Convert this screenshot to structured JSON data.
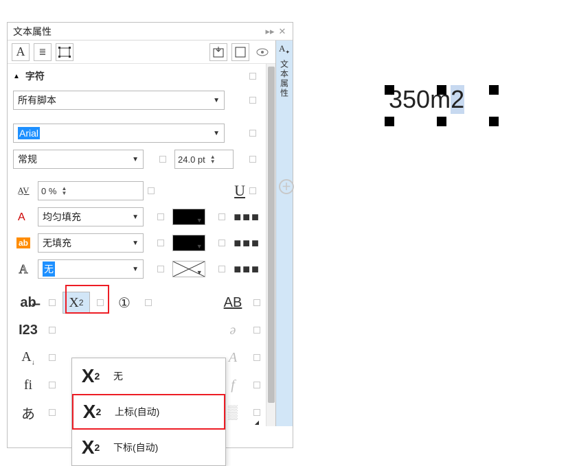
{
  "panel": {
    "title": "文本属性",
    "side_tab_label": "文本属性"
  },
  "section": {
    "title": "字符"
  },
  "fields": {
    "script": {
      "value": "所有脚本"
    },
    "font_family": {
      "value": "Arial"
    },
    "font_style": {
      "value": "常规"
    },
    "font_size": {
      "value": "24.0 pt"
    },
    "kerning": {
      "value": "0 %"
    },
    "fill_type": {
      "value": "均匀填充"
    },
    "bg_fill_type": {
      "value": "无填充"
    },
    "outline": {
      "value": "无"
    },
    "underline_label": "U"
  },
  "popup": {
    "items": [
      {
        "label": "无",
        "mode": "sup"
      },
      {
        "label": "上标(自动)",
        "mode": "sup"
      },
      {
        "label": "下标(自动)",
        "mode": "sub"
      }
    ]
  },
  "canvas": {
    "text_main": "350m",
    "text_sel": "2"
  }
}
